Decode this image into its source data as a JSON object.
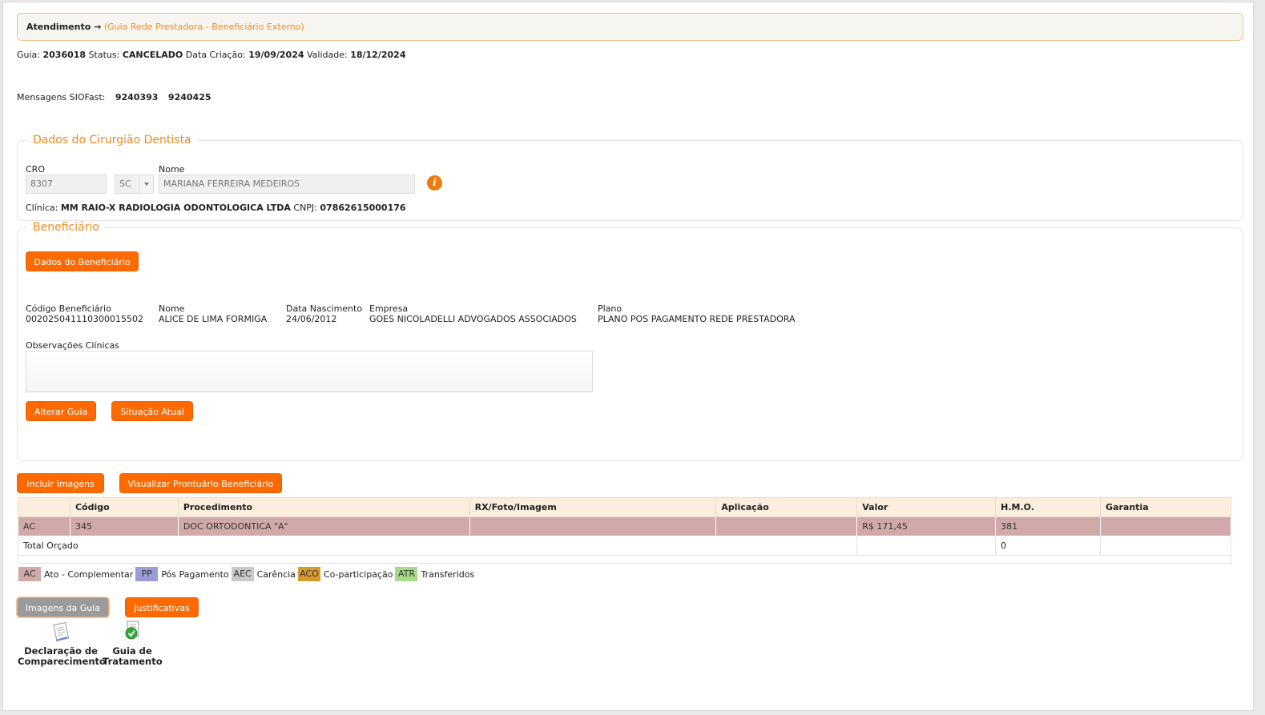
{
  "breadcrumb": {
    "main": "Atendimento →",
    "sub": "(Guia Rede Prestadora - Beneficiário Externo)"
  },
  "guia": {
    "guia_label": "Guia:",
    "guia_value": "2036018",
    "status_label": "Status:",
    "status_value": "CANCELADO",
    "criacao_label": "Data Criação:",
    "criacao_value": "19/09/2024",
    "validade_label": "Validade:",
    "validade_value": "18/12/2024"
  },
  "mensagens": {
    "label": "Mensagens SIOFast:",
    "values": [
      "9240393",
      "9240425"
    ]
  },
  "dentista": {
    "title": "Dados do Cirurgião Dentista",
    "cro_label": "CRO",
    "cro_value": "8307",
    "uf_value": "SC",
    "nome_label": "Nome",
    "nome_value": "MARIANA FERREIRA MEDEIROS",
    "info_icon_glyph": "i",
    "clinica_label": "Clínica:",
    "clinica_value": "MM RAIO-X RADIOLOGIA ODONTOLOGICA LTDA",
    "cnpj_label": "CNPJ:",
    "cnpj_value": "07862615000176"
  },
  "beneficiario": {
    "title": "Beneficiário",
    "dados_button": "Dados do Beneficiário",
    "fields": [
      {
        "label": "Código Beneficiário",
        "value": "00202504111030001550​2"
      },
      {
        "label": "Nome",
        "value": "ALICE DE LIMA FORMIGA"
      },
      {
        "label": "Data Nascimento",
        "value": "24/06/2012"
      },
      {
        "label": "Empresa",
        "value": "GOES NICOLADELLI ADVOGADOS ASSOCIADOS"
      },
      {
        "label": "Plano",
        "value": "PLANO POS PAGAMENTO REDE PRESTADORA"
      }
    ],
    "observacoes_label": "Observações Clínicas",
    "alterar_button": "Alterar Guia",
    "situacao_button": "Situação Atual"
  },
  "actions": {
    "incluir_button": "Incluir Imagens",
    "prontuario_button": "Visualizar Prontuário Beneficiário"
  },
  "table": {
    "headers": [
      "",
      "Código",
      "Procedimento",
      "RX/Foto/Imagem",
      "Aplicação",
      "Valor",
      "H.M.O.",
      "Garantia"
    ],
    "rows": [
      {
        "tipo": "AC",
        "codigo": "345",
        "procedimento": "DOC ORTODONTICA \"A\"",
        "rx": "",
        "aplicacao": "",
        "valor": "R$ 171,45",
        "hmo": "381",
        "garantia": ""
      }
    ],
    "total_label": "Total Orçado",
    "total_valor": "",
    "total_hmo": "0"
  },
  "legend": [
    {
      "code": "AC",
      "text": "Ato - Complementar",
      "color": "#d1a9a9"
    },
    {
      "code": "PP",
      "text": "Pós Pagamento",
      "color": "#9c9cd6"
    },
    {
      "code": "AEC",
      "text": "Carência",
      "color": "#c9c9c9"
    },
    {
      "code": "ACO",
      "text": "Co-participação",
      "color": "#d69a2e"
    },
    {
      "code": "ATR",
      "text": "Transferidos",
      "color": "#a6d98a"
    }
  ],
  "bottom": {
    "imagens_button": "Imagens da Guia",
    "justificativas_button": "Justificativas",
    "doc1_line1": "Declaração de",
    "doc1_line2": "Comparecimento",
    "doc2_line1": "Guia de",
    "doc2_line2": "Tratamento"
  },
  "colors": {
    "accent": "#ff6a00",
    "title_orange": "#ef8a1a"
  }
}
